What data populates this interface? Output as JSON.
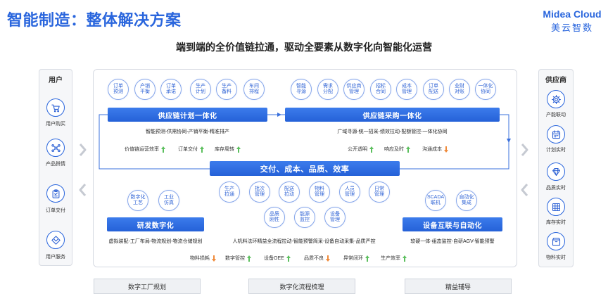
{
  "header": {
    "title": "智能制造：整体解决方案",
    "logo_en": "Midea Cloud",
    "logo_cn": "美云智数",
    "subtitle": "端到端的全价值链拉通，驱动全要素从数字化向智能化运营"
  },
  "colors": {
    "primary": "#2a66dd",
    "bar_top": "#3c7cec",
    "bar_bottom": "#2561d8",
    "up": "#5cbf5e",
    "down": "#ef8a3a"
  },
  "users": {
    "title": "用户",
    "items": [
      {
        "label": "用户购买",
        "icon": "cart-icon"
      },
      {
        "label": "产品舆情",
        "icon": "network-icon"
      },
      {
        "label": "订单交付",
        "icon": "clipboard-icon"
      },
      {
        "label": "用户服务",
        "icon": "service-icon"
      }
    ]
  },
  "suppliers": {
    "title": "供应商",
    "items": [
      {
        "label": "产能联动",
        "icon": "gear-icon"
      },
      {
        "label": "计划实时",
        "icon": "calendar-icon"
      },
      {
        "label": "品质实时",
        "icon": "diamond-icon"
      },
      {
        "label": "库存实时",
        "icon": "grid-icon"
      },
      {
        "label": "物料实时",
        "icon": "box-icon"
      }
    ]
  },
  "plan": {
    "title": "供应链计划一体化",
    "circles": [
      [
        "订单",
        "预测"
      ],
      [
        "产销",
        "平衡"
      ],
      [
        "订单",
        "承诺"
      ],
      [
        "生产",
        "计划"
      ],
      [
        "生产",
        "备料"
      ],
      [
        "车间",
        "排程"
      ]
    ],
    "desc": "智能预测-供需协同-产销平衡-精准排产",
    "kpis": [
      {
        "label": "价值链运营效率",
        "icon": "arrow-up-icon"
      },
      {
        "label": "订单交付",
        "icon": "arrow-up-icon"
      },
      {
        "label": "库存周转",
        "icon": "arrow-up-icon"
      }
    ]
  },
  "procure": {
    "title": "供应链采购一体化",
    "circles": [
      [
        "智能",
        "寻源"
      ],
      [
        "需求",
        "分配"
      ],
      [
        "供应商",
        "管理"
      ],
      [
        "招标",
        "合同"
      ],
      [
        "成本",
        "管理"
      ],
      [
        "订单",
        "配送"
      ],
      [
        "业财",
        "对账"
      ],
      [
        "一体化",
        "协同"
      ]
    ],
    "desc": "广域寻源-统一招采-绩效拉动-配额管控-一体化协同",
    "kpis": [
      {
        "label": "公开透明",
        "icon": "arrow-up-icon"
      },
      {
        "label": "响应及时",
        "icon": "arrow-up-icon"
      },
      {
        "label": "沟通成本",
        "icon": "arrow-down-icon"
      }
    ]
  },
  "center": {
    "title": "交付、成本、品质、效率"
  },
  "rd": {
    "title": "研发数字化",
    "circles": [
      [
        "数字化",
        "工艺"
      ],
      [
        "工业",
        "仿真"
      ]
    ],
    "desc": "虚拟装配-工厂布局-物流规划-物流仓储规划"
  },
  "production": {
    "circles": [
      [
        "生产",
        "拉通"
      ],
      [
        "批次",
        "管理"
      ],
      [
        "配送",
        "拉动"
      ],
      [
        "物料",
        "管理"
      ],
      [
        "人员",
        "管理"
      ],
      [
        "日常",
        "管理"
      ],
      [
        "品质",
        "刚性"
      ],
      [
        "能源",
        "监控"
      ],
      [
        "设备",
        "管理"
      ]
    ],
    "desc": "人机料法环精益全流程拉动-智能预警简采-设备自动采集-品质严控"
  },
  "device": {
    "title": "设备互联与自动化",
    "circles": [
      [
        "SCADA",
        "联机"
      ],
      [
        "自动化",
        "集成"
      ]
    ],
    "desc": "软硬一体-组态监控-自研AGV-智能预警"
  },
  "bottom_kpis": [
    {
      "label": "物料损耗",
      "icon": "arrow-down-icon"
    },
    {
      "label": "数字管控",
      "icon": "arrow-up-icon"
    },
    {
      "label": "设备OEE",
      "icon": "arrow-up-icon"
    },
    {
      "label": "品质不良",
      "icon": "arrow-down-icon"
    },
    {
      "label": "异常闭环",
      "icon": "arrow-up-icon"
    },
    {
      "label": "生产效率",
      "icon": "arrow-up-icon"
    }
  ],
  "services": [
    "数字工厂规划",
    "数字化流程梳理",
    "精益辅导"
  ]
}
